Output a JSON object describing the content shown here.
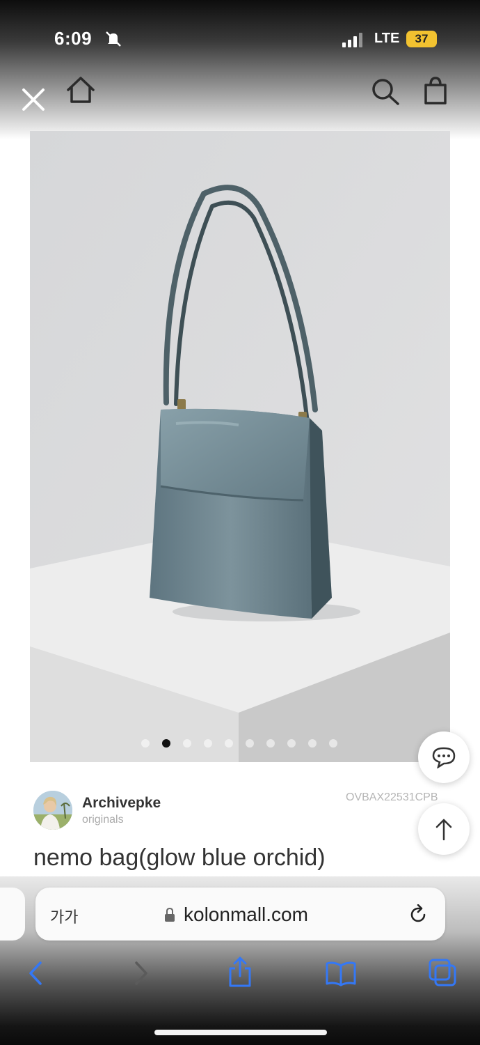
{
  "status_bar": {
    "time": "6:09",
    "network": "LTE",
    "battery": "37"
  },
  "gallery": {
    "dot_count": 10,
    "active_index": 1
  },
  "brand": {
    "name": "Archivepke",
    "subtitle": "originals"
  },
  "product": {
    "code": "OVBAX22531CPB",
    "title": "nemo bag(glow blue orchid)"
  },
  "browser": {
    "text_size_label": "가가",
    "url": "kolonmall.com"
  },
  "colors": {
    "bag": "#6d848d",
    "background": "#dcdcdc",
    "accent_ios": "#3478f6"
  }
}
